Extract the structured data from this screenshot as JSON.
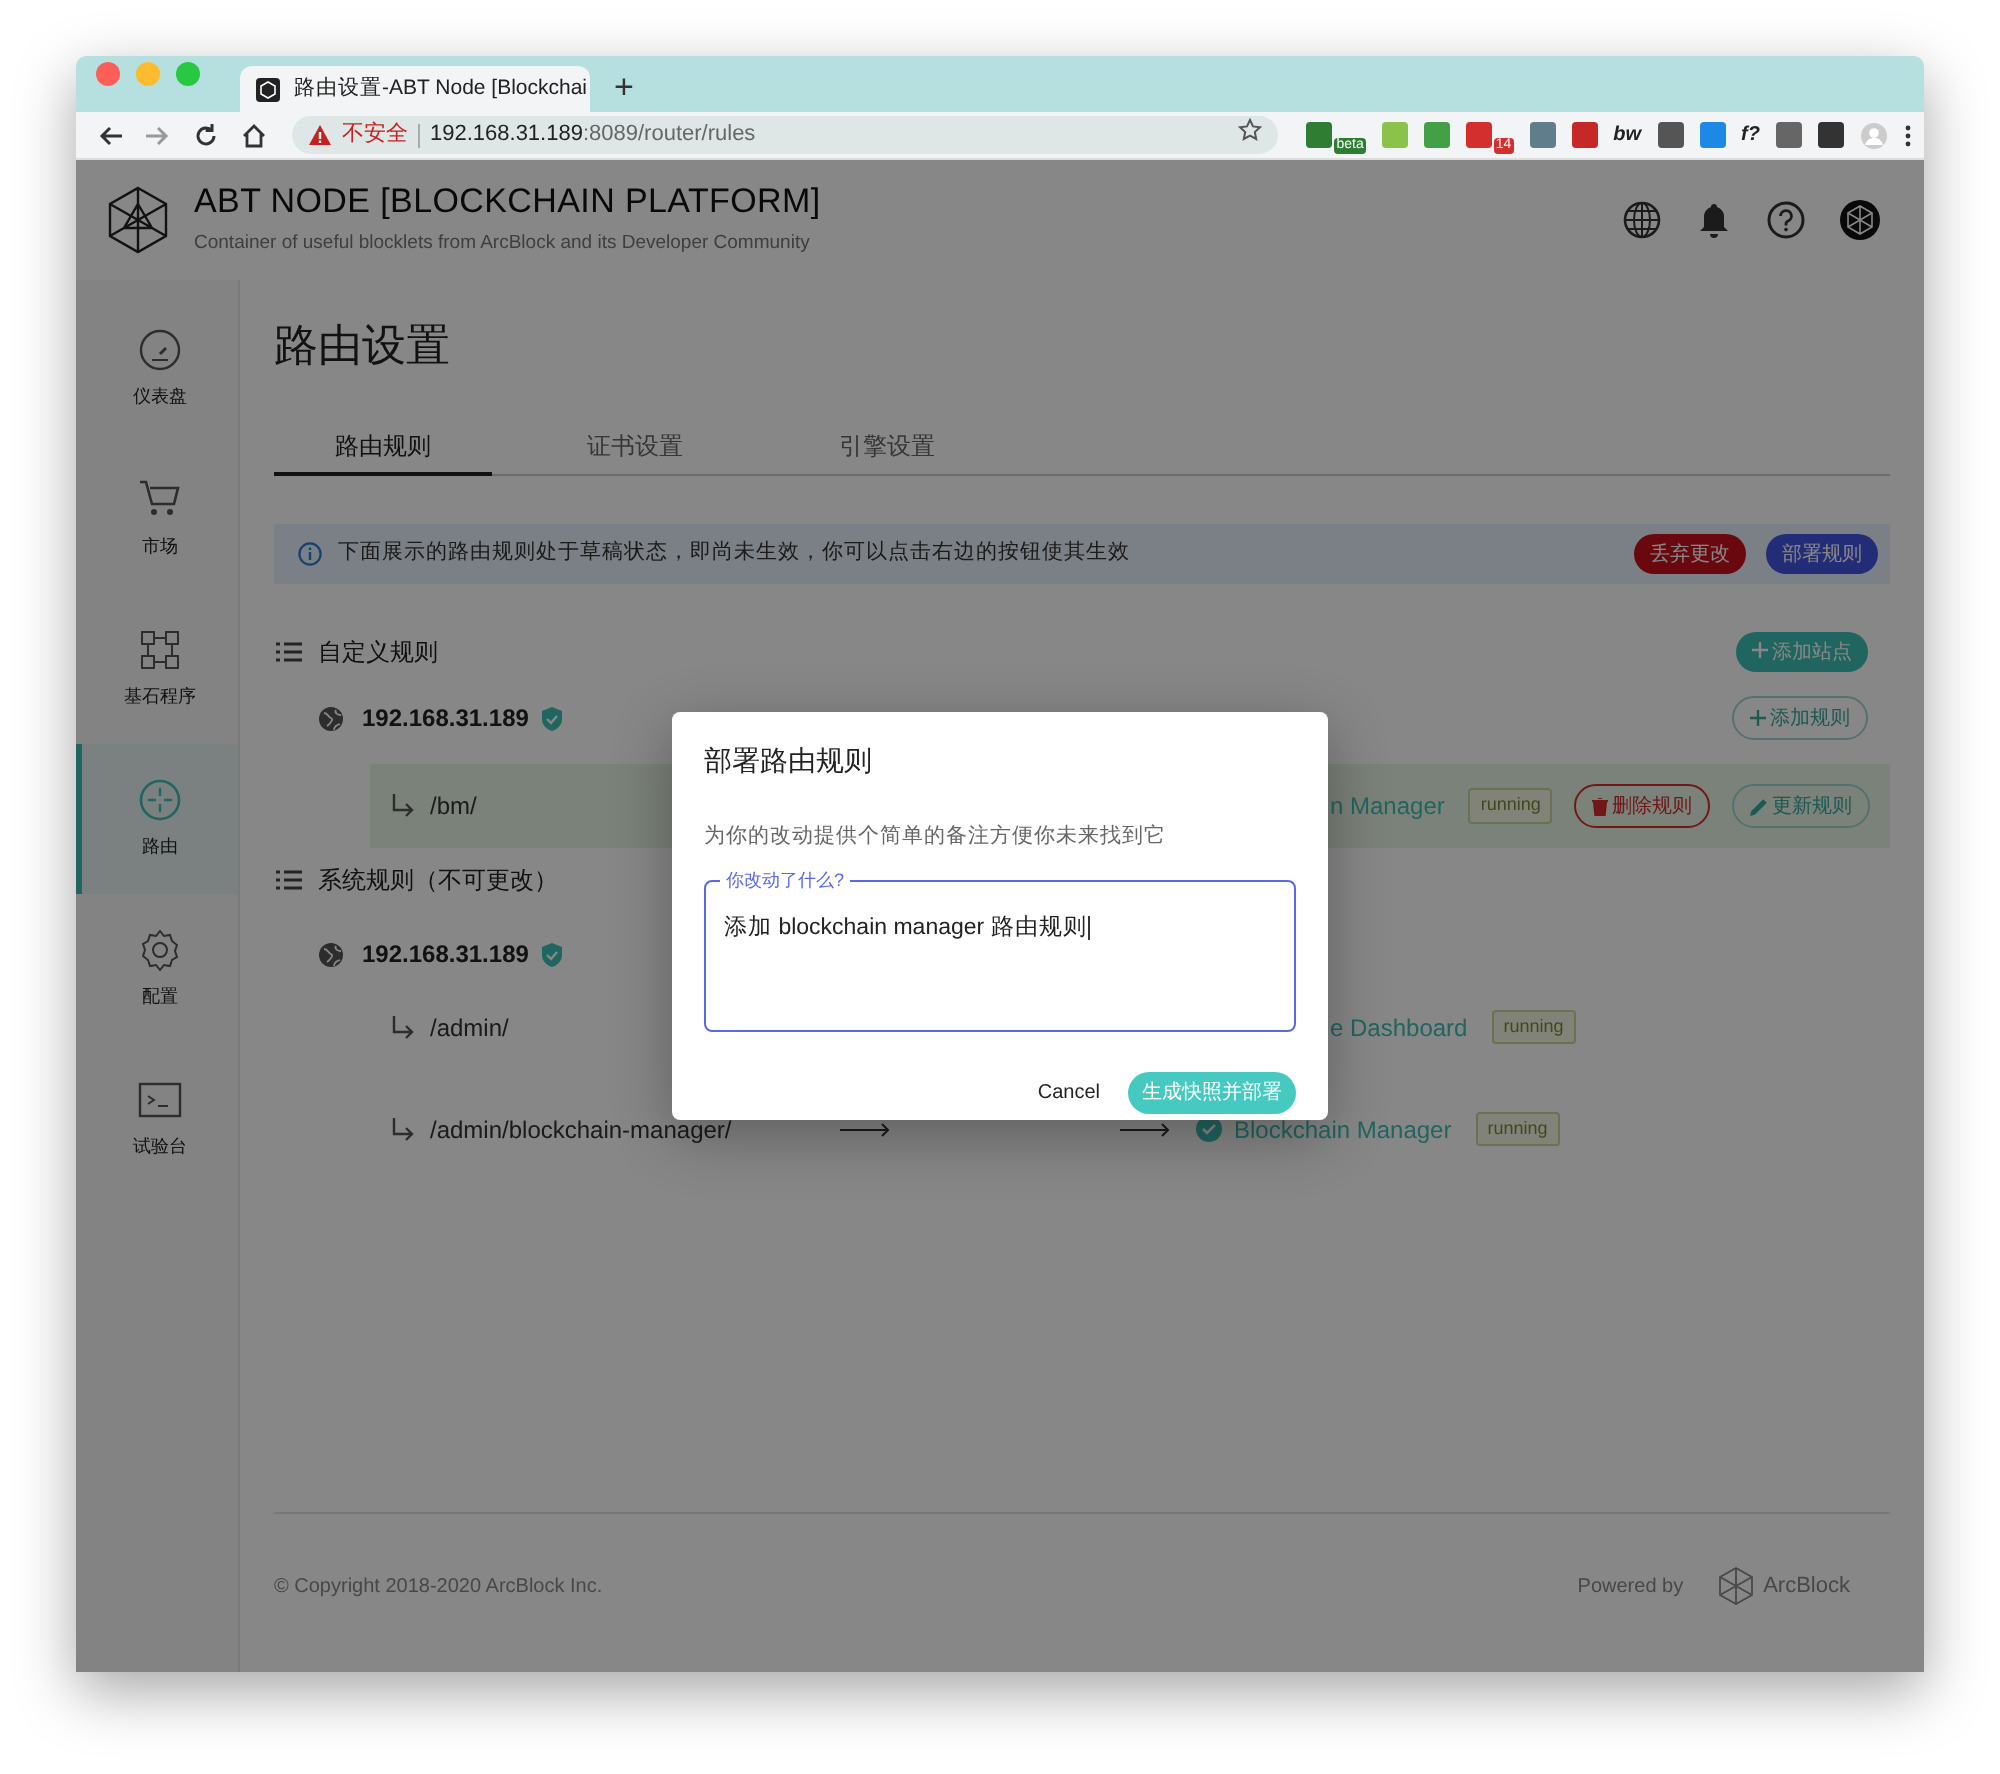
{
  "browser": {
    "tab_title": "路由设置-ABT Node [Blockchai",
    "new_tab": "+",
    "url": {
      "warning": "不安全",
      "host": "192.168.31.189",
      "path": ":8089/router/rules"
    },
    "extensions": [
      {
        "color": "#2e7d32",
        "badge": "beta"
      },
      {
        "color": "#8bc34a"
      },
      {
        "color": "#43a047"
      },
      {
        "color": "#d32f2f",
        "badge": "14"
      },
      {
        "color": "#607d8b"
      },
      {
        "color": "#c62828"
      },
      {
        "label": "bw"
      },
      {
        "color": "#555555"
      },
      {
        "color": "#1e88e5"
      },
      {
        "label": "f?"
      },
      {
        "color": "#666666"
      },
      {
        "color": "#333333"
      }
    ]
  },
  "header": {
    "title": "ABT NODE [BLOCKCHAIN PLATFORM]",
    "subtitle": "Container of useful blocklets from ArcBlock and its Developer Community"
  },
  "sidebar": {
    "items": [
      {
        "label": "仪表盘",
        "selected": false
      },
      {
        "label": "市场",
        "selected": false
      },
      {
        "label": "基石程序",
        "selected": false
      },
      {
        "label": "路由",
        "selected": true
      },
      {
        "label": "配置",
        "selected": false
      },
      {
        "label": "试验台",
        "selected": false
      }
    ]
  },
  "page_title": "路由设置",
  "tabs": [
    {
      "label": "路由规则",
      "selected": true
    },
    {
      "label": "证书设置",
      "selected": false
    },
    {
      "label": "引擎设置",
      "selected": false
    }
  ],
  "alert": {
    "text": "下面展示的路由规则处于草稿状态，即尚未生效，你可以点击右边的按钮使其生效",
    "buttons": [
      {
        "label": "丢弃更改",
        "kind": "danger"
      },
      {
        "label": "部署规则",
        "kind": "primary"
      }
    ]
  },
  "sections": [
    {
      "title": "自定义规则",
      "action": "添加站点",
      "sites": [
        {
          "host": "192.168.31.189",
          "verified": true,
          "action": "添加规则",
          "rules": [
            {
              "path": "/bm/",
              "arrows": false,
              "target": "n Manager",
              "status": "running",
              "highlighted": true,
              "actions": [
                {
                  "label": "删除规则",
                  "kind": "delete"
                },
                {
                  "label": "更新规则",
                  "kind": "edit"
                }
              ]
            }
          ]
        }
      ]
    },
    {
      "title": "系统规则（不可更改）",
      "sites": [
        {
          "host": "192.168.31.189",
          "verified": true,
          "rules": [
            {
              "path": "/admin/",
              "arrows": false,
              "target": "e Dashboard",
              "status": "running",
              "highlighted": false
            },
            {
              "path": "/admin/blockchain-manager/",
              "arrows": true,
              "target": "Blockchain Manager",
              "status": "running",
              "highlighted": false
            }
          ]
        }
      ]
    }
  ],
  "footer": {
    "copyright": "© Copyright 2018-2020  ArcBlock Inc.",
    "powered_by": "Powered by",
    "brand": "ArcBlock"
  },
  "modal": {
    "title": "部署路由规则",
    "description": "为你的改动提供个简单的备注方便你未来找到它",
    "field": {
      "label": "你改动了什么?",
      "value": "添加 blockchain manager 路由规则",
      "focused": true
    },
    "buttons": [
      {
        "label": "Cancel",
        "kind": "text"
      },
      {
        "label": "生成快照并部署",
        "kind": "primary"
      }
    ]
  }
}
